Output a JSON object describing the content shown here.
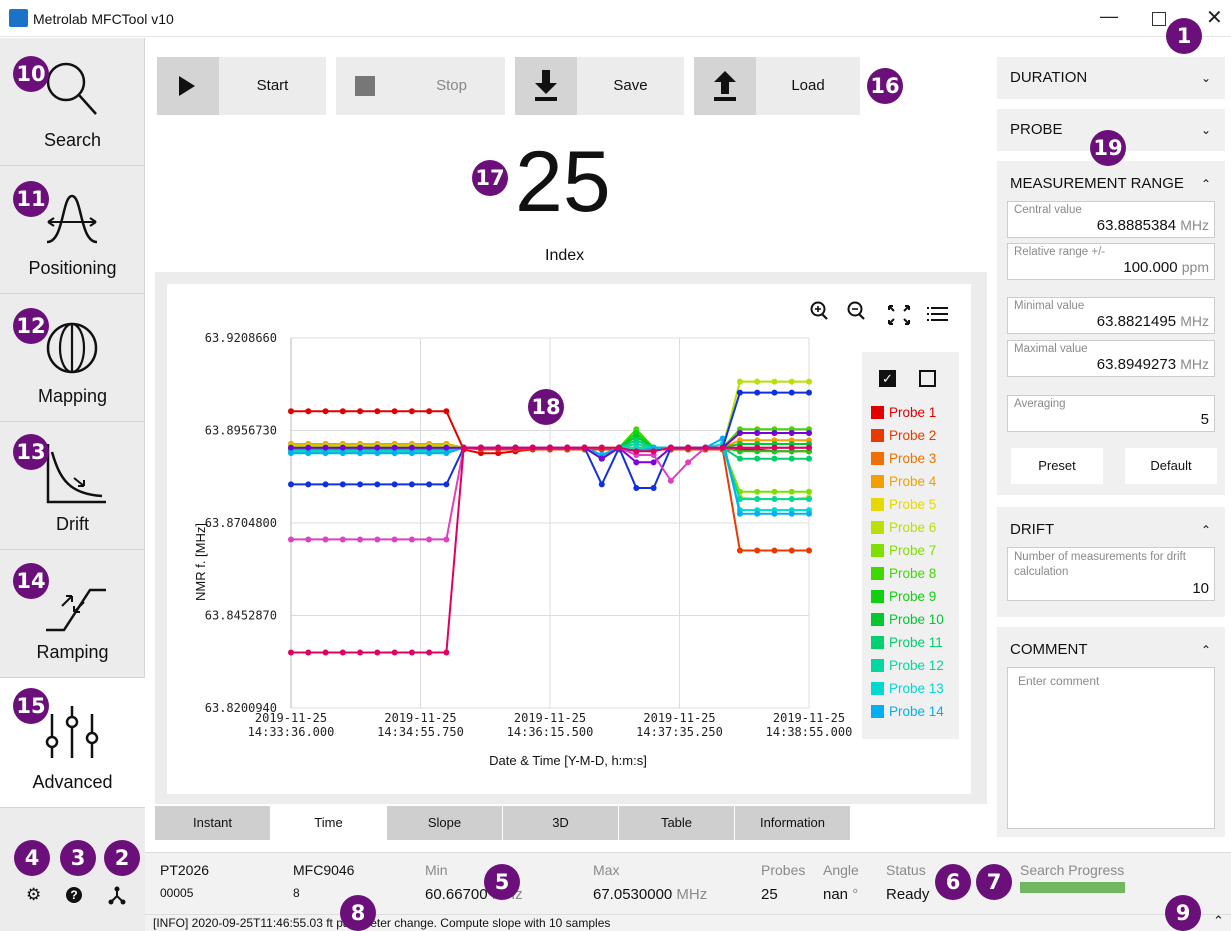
{
  "window": {
    "title": "Metrolab MFCTool v10"
  },
  "nav": [
    {
      "label": "Search"
    },
    {
      "label": "Positioning"
    },
    {
      "label": "Mapping"
    },
    {
      "label": "Drift"
    },
    {
      "label": "Ramping"
    },
    {
      "label": "Advanced"
    }
  ],
  "toolbar": {
    "start": "Start",
    "stop": "Stop",
    "save": "Save",
    "load": "Load"
  },
  "index": {
    "value": "25",
    "label": "Index"
  },
  "chart_data": {
    "type": "line",
    "ylabel": "NMR f. [MHz]",
    "xlabel": "Date & Time [Y-M-D, h:m:s]",
    "ylim": [
      63.820094,
      63.920866
    ],
    "yticks": [
      "63.9208660",
      "63.8956730",
      "63.8704800",
      "63.8452870",
      "63.8200940"
    ],
    "xticks": [
      [
        "2019-11-25",
        "14:33:36.000"
      ],
      [
        "2019-11-25",
        "14:34:55.750"
      ],
      [
        "2019-11-25",
        "14:36:15.500"
      ],
      [
        "2019-11-25",
        "14:37:35.250"
      ],
      [
        "2019-11-25",
        "14:38:55.000"
      ]
    ],
    "series": [
      {
        "name": "Probe 1",
        "color": "#e00000",
        "values": [
          63.9009,
          63.9009,
          63.9009,
          63.9009,
          63.9009,
          63.9009,
          63.9009,
          63.9009,
          63.9009,
          63.9009,
          63.8905,
          63.8895,
          63.8895,
          63.89,
          63.8905,
          63.8905,
          63.8905,
          63.891,
          63.8905,
          63.8905,
          63.8905,
          63.8905,
          63.8905,
          63.8905,
          63.8905,
          63.8905,
          63.8905,
          63.8905,
          63.89,
          63.89,
          63.89
        ]
      },
      {
        "name": "Probe 2",
        "color": "#e83a00",
        "values": [
          63.891,
          63.891,
          63.891,
          63.891,
          63.891,
          63.891,
          63.891,
          63.891,
          63.891,
          63.891,
          63.891,
          63.8905,
          63.8905,
          63.8905,
          63.8905,
          63.8905,
          63.8905,
          63.8905,
          63.8905,
          63.8905,
          63.8905,
          63.8905,
          63.8905,
          63.8905,
          63.8905,
          63.8905,
          63.863,
          63.863,
          63.863,
          63.863,
          63.863
        ]
      },
      {
        "name": "Probe 3",
        "color": "#ee7000",
        "values": [
          63.892,
          63.892,
          63.892,
          63.892,
          63.892,
          63.892,
          63.892,
          63.892,
          63.892,
          63.892,
          63.891,
          63.891,
          63.891,
          63.891,
          63.891,
          63.891,
          63.891,
          63.891,
          63.891,
          63.891,
          63.891,
          63.891,
          63.891,
          63.891,
          63.891,
          63.891,
          63.895,
          63.895,
          63.895,
          63.895,
          63.895
        ]
      },
      {
        "name": "Probe 4",
        "color": "#f0a000",
        "values": [
          63.892,
          63.892,
          63.892,
          63.892,
          63.892,
          63.892,
          63.892,
          63.892,
          63.892,
          63.892,
          63.891,
          63.891,
          63.891,
          63.891,
          63.891,
          63.891,
          63.891,
          63.891,
          63.891,
          63.891,
          63.891,
          63.891,
          63.891,
          63.891,
          63.891,
          63.891,
          63.893,
          63.893,
          63.893,
          63.893,
          63.893
        ]
      },
      {
        "name": "Probe 5",
        "color": "#e6d800",
        "values": [
          63.8915,
          63.8915,
          63.8915,
          63.8915,
          63.8915,
          63.8915,
          63.8915,
          63.8915,
          63.8915,
          63.8915,
          63.891,
          63.891,
          63.891,
          63.891,
          63.891,
          63.891,
          63.891,
          63.891,
          63.891,
          63.891,
          63.891,
          63.891,
          63.891,
          63.891,
          63.891,
          63.891,
          63.8775,
          63.877,
          63.877,
          63.877,
          63.8775
        ]
      },
      {
        "name": "Probe 6",
        "color": "#b8e000",
        "values": [
          63.8915,
          63.8915,
          63.8915,
          63.8915,
          63.8915,
          63.8915,
          63.8915,
          63.8915,
          63.8915,
          63.8915,
          63.891,
          63.891,
          63.891,
          63.891,
          63.891,
          63.891,
          63.891,
          63.891,
          63.891,
          63.891,
          63.893,
          63.891,
          63.891,
          63.891,
          63.891,
          63.891,
          63.909,
          63.909,
          63.909,
          63.909,
          63.909
        ]
      },
      {
        "name": "Probe 7",
        "color": "#7fe000",
        "values": [
          63.891,
          63.891,
          63.891,
          63.891,
          63.891,
          63.891,
          63.891,
          63.891,
          63.891,
          63.891,
          63.891,
          63.891,
          63.891,
          63.891,
          63.891,
          63.891,
          63.891,
          63.891,
          63.891,
          63.891,
          63.891,
          63.891,
          63.891,
          63.891,
          63.891,
          63.891,
          63.879,
          63.879,
          63.879,
          63.879,
          63.879
        ]
      },
      {
        "name": "Probe 8",
        "color": "#40d800",
        "values": [
          63.8905,
          63.8905,
          63.8905,
          63.8905,
          63.8905,
          63.8905,
          63.8905,
          63.8905,
          63.8905,
          63.8905,
          63.891,
          63.891,
          63.891,
          63.891,
          63.891,
          63.891,
          63.891,
          63.891,
          63.888,
          63.891,
          63.896,
          63.891,
          63.891,
          63.891,
          63.891,
          63.891,
          63.896,
          63.896,
          63.896,
          63.896,
          63.896
        ]
      },
      {
        "name": "Probe 9",
        "color": "#10d010",
        "values": [
          63.8905,
          63.8905,
          63.8905,
          63.8905,
          63.8905,
          63.8905,
          63.8905,
          63.8905,
          63.8905,
          63.8905,
          63.891,
          63.891,
          63.891,
          63.891,
          63.891,
          63.891,
          63.891,
          63.891,
          63.888,
          63.891,
          63.895,
          63.891,
          63.891,
          63.891,
          63.891,
          63.891,
          63.89,
          63.89,
          63.89,
          63.89,
          63.89
        ]
      },
      {
        "name": "Probe 10",
        "color": "#00c830",
        "values": [
          63.8905,
          63.8905,
          63.8905,
          63.8905,
          63.8905,
          63.8905,
          63.8905,
          63.8905,
          63.8905,
          63.8905,
          63.891,
          63.891,
          63.891,
          63.891,
          63.891,
          63.891,
          63.891,
          63.891,
          63.888,
          63.891,
          63.894,
          63.891,
          63.891,
          63.891,
          63.891,
          63.891,
          63.892,
          63.892,
          63.892,
          63.892,
          63.892
        ]
      },
      {
        "name": "Probe 11",
        "color": "#00d070",
        "values": [
          63.89,
          63.89,
          63.89,
          63.89,
          63.89,
          63.89,
          63.89,
          63.89,
          63.89,
          63.89,
          63.891,
          63.891,
          63.891,
          63.891,
          63.891,
          63.891,
          63.891,
          63.891,
          63.889,
          63.891,
          63.893,
          63.891,
          63.891,
          63.891,
          63.891,
          63.891,
          63.888,
          63.888,
          63.888,
          63.888,
          63.888
        ]
      },
      {
        "name": "Probe 12",
        "color": "#00d8a0",
        "values": [
          63.89,
          63.89,
          63.89,
          63.89,
          63.89,
          63.89,
          63.89,
          63.89,
          63.89,
          63.89,
          63.891,
          63.891,
          63.891,
          63.891,
          63.891,
          63.891,
          63.891,
          63.891,
          63.889,
          63.891,
          63.892,
          63.891,
          63.891,
          63.891,
          63.891,
          63.891,
          63.877,
          63.877,
          63.877,
          63.877,
          63.877
        ]
      },
      {
        "name": "Probe 13",
        "color": "#00d8d0",
        "values": [
          63.89,
          63.89,
          63.89,
          63.89,
          63.89,
          63.89,
          63.89,
          63.89,
          63.89,
          63.89,
          63.891,
          63.891,
          63.891,
          63.891,
          63.891,
          63.891,
          63.891,
          63.891,
          63.889,
          63.891,
          63.891,
          63.891,
          63.891,
          63.891,
          63.891,
          63.892,
          63.874,
          63.874,
          63.874,
          63.874,
          63.874
        ]
      },
      {
        "name": "Probe 14",
        "color": "#00b0f0",
        "values": [
          63.8895,
          63.8895,
          63.8895,
          63.8895,
          63.8895,
          63.8895,
          63.8895,
          63.8895,
          63.8895,
          63.8895,
          63.891,
          63.891,
          63.891,
          63.891,
          63.891,
          63.891,
          63.891,
          63.891,
          63.889,
          63.891,
          63.89,
          63.891,
          63.891,
          63.891,
          63.891,
          63.8935,
          63.873,
          63.873,
          63.873,
          63.873,
          63.873
        ]
      },
      {
        "name": "",
        "color": "#1030e0",
        "values": [
          63.881,
          63.881,
          63.881,
          63.881,
          63.881,
          63.881,
          63.881,
          63.881,
          63.881,
          63.881,
          63.891,
          63.891,
          63.891,
          63.891,
          63.891,
          63.891,
          63.891,
          63.891,
          63.881,
          63.891,
          63.88,
          63.88,
          63.891,
          63.891,
          63.891,
          63.891,
          63.906,
          63.906,
          63.906,
          63.906,
          63.906
        ]
      },
      {
        "name": "",
        "color": "#7a00e0",
        "values": [
          63.891,
          63.891,
          63.891,
          63.891,
          63.891,
          63.891,
          63.891,
          63.891,
          63.891,
          63.891,
          63.891,
          63.891,
          63.891,
          63.891,
          63.891,
          63.891,
          63.891,
          63.891,
          63.888,
          63.891,
          63.887,
          63.887,
          63.891,
          63.891,
          63.891,
          63.891,
          63.895,
          63.895,
          63.895,
          63.895,
          63.895
        ]
      },
      {
        "name": "",
        "color": "#e040c0",
        "values": [
          63.866,
          63.866,
          63.866,
          63.866,
          63.866,
          63.866,
          63.866,
          63.866,
          63.866,
          63.866,
          63.891,
          63.891,
          63.891,
          63.891,
          63.891,
          63.891,
          63.891,
          63.891,
          63.891,
          63.891,
          63.889,
          63.889,
          63.882,
          63.887,
          63.891,
          63.891,
          63.891,
          63.891,
          63.891,
          63.891,
          63.891
        ]
      },
      {
        "name": "",
        "color": "#e00060",
        "values": [
          63.8352,
          63.8352,
          63.8352,
          63.8352,
          63.8352,
          63.8352,
          63.8352,
          63.8352,
          63.8352,
          63.8352,
          63.891,
          63.891,
          63.891,
          63.891,
          63.891,
          63.891,
          63.891,
          63.891,
          63.891,
          63.891,
          63.89,
          63.89,
          63.891,
          63.891,
          63.891,
          63.891,
          63.891,
          63.891,
          63.891,
          63.891,
          63.891
        ]
      }
    ]
  },
  "tabs": [
    "Instant",
    "Time",
    "Slope",
    "3D",
    "Table",
    "Information"
  ],
  "panel": {
    "duration": "DURATION",
    "probe": "PROBE",
    "range": {
      "title": "MEASUREMENT RANGE",
      "central_label": "Central value",
      "central_value": "63.8885384",
      "central_unit": "MHz",
      "rel_label": "Relative range +/-",
      "rel_value": "100.000",
      "rel_unit": "ppm",
      "min_label": "Minimal value",
      "min_value": "63.8821495",
      "min_unit": "MHz",
      "max_label": "Maximal value",
      "max_value": "63.8949273",
      "max_unit": "MHz",
      "avg_label": "Averaging",
      "avg_value": "5",
      "preset": "Preset",
      "default": "Default"
    },
    "drift": {
      "title": "DRIFT",
      "label": "Number of measurements for drift calculation",
      "value": "10"
    },
    "comment": {
      "title": "COMMENT",
      "placeholder": "Enter comment"
    }
  },
  "info": {
    "device": "PT2026",
    "serial": "00005",
    "mfc": "MFC9046",
    "mfc_val": "8",
    "min_label": "Min",
    "min_val": "60.66700",
    "min_unit": "MHz",
    "max_label": "Max",
    "max_val": "67.0530000",
    "max_unit": "MHz",
    "probes_label": "Probes",
    "probes_val": "25",
    "angle_label": "Angle",
    "angle_val": "nan",
    "angle_unit": "°",
    "status_label": "Status",
    "status_val": "Ready",
    "progress_label": "Search Progress",
    "progress": 1.0
  },
  "status_message": "[INFO] 2020-09-25T11:46:55.03 ft parameter change. Compute slope with 10 samples",
  "callouts": [
    "1",
    "2",
    "3",
    "4",
    "5",
    "6",
    "7",
    "8",
    "9",
    "10",
    "11",
    "12",
    "13",
    "14",
    "15",
    "16",
    "17",
    "18",
    "19"
  ]
}
